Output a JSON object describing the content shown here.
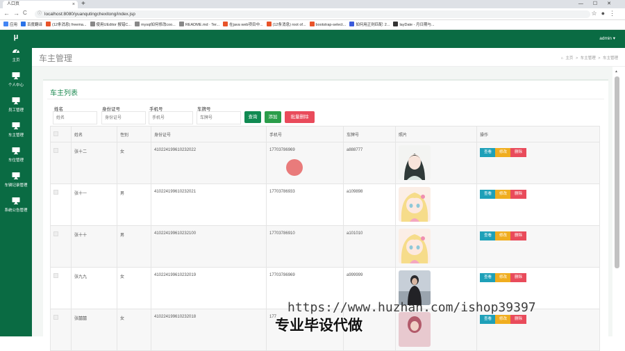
{
  "browser": {
    "tab_title": "人口页",
    "tab_close": "×",
    "new_tab": "+",
    "window_controls": "—☐✕",
    "back": "←",
    "forward": "→",
    "reload": "C",
    "url": "localhost:8080/yuanqutingchexitong/index.jsp",
    "star": "☆"
  },
  "bookmarks": [
    {
      "label": "应用",
      "color": "#4285f4"
    },
    {
      "label": "百度翻译",
      "color": "#2a73e8"
    },
    {
      "label": "(12条消息) freema...",
      "color": "#e8542a"
    },
    {
      "label": "使用UEditor 报错C...",
      "color": "#888888"
    },
    {
      "label": "mysql如何修改coo...",
      "color": "#888888"
    },
    {
      "label": "README.md · Ter...",
      "color": "#888888"
    },
    {
      "label": "在java web项目中...",
      "color": "#e8542a"
    },
    {
      "label": "(12条消息) root of...",
      "color": "#e8542a"
    },
    {
      "label": "bootstrap-select...",
      "color": "#e8542a"
    },
    {
      "label": "如何用正则匹配: 2...",
      "color": "#3b5bdb"
    },
    {
      "label": "layDate - 月日期与...",
      "color": "#333333"
    }
  ],
  "sidebar": {
    "logo": "μ",
    "items": [
      {
        "label": "主页",
        "icon": "dashboard-icon"
      },
      {
        "label": "个人中心",
        "icon": "monitor-icon"
      },
      {
        "label": "员工管理",
        "icon": "monitor-icon"
      },
      {
        "label": "车主管理",
        "icon": "monitor-icon"
      },
      {
        "label": "车位管理",
        "icon": "monitor-icon"
      },
      {
        "label": "车辆记录管理",
        "icon": "monitor-icon"
      },
      {
        "label": "系统公告管理",
        "icon": "monitor-icon"
      }
    ]
  },
  "topbar": {
    "user": "admin ▾"
  },
  "page": {
    "title": "车主管理",
    "crumbs": [
      "主页",
      "车主管理",
      "车主管理"
    ]
  },
  "card": {
    "title": "车主列表"
  },
  "filters": [
    {
      "label": "姓名",
      "placeholder": "姓名"
    },
    {
      "label": "身份证号",
      "placeholder": "身份证号"
    },
    {
      "label": "手机号",
      "placeholder": "手机号"
    },
    {
      "label": "车牌号",
      "placeholder": "车牌号"
    }
  ],
  "buttons": {
    "search": "查询",
    "add": "添加",
    "batch_delete": "批量删除"
  },
  "table": {
    "headers": [
      "姓名",
      "性别",
      "身份证号",
      "手机号",
      "车牌号",
      "照片",
      "操作"
    ],
    "actions": [
      "查看",
      "修改",
      "删除"
    ],
    "rows": [
      {
        "name": "张十二",
        "gender": "女",
        "id": "410224199610232022",
        "phone": "17703786969",
        "plate": "a888777",
        "photo": "girl-illustration"
      },
      {
        "name": "张十一",
        "gender": "男",
        "id": "410224199610232021",
        "phone": "17703786933",
        "plate": "a109898",
        "photo": "anime-girl"
      },
      {
        "name": "张十十",
        "gender": "男",
        "id": "410224199610232100",
        "phone": "17703786910",
        "plate": "a101010",
        "photo": "anime-girl"
      },
      {
        "name": "张九九",
        "gender": "女",
        "id": "410224199610232019",
        "phone": "17703786969",
        "plate": "a999999",
        "photo": "person-photo"
      },
      {
        "name": "张囍囍",
        "gender": "女",
        "id": "410224199610232018",
        "phone": "177",
        "plate": "",
        "photo": "person-photo-2"
      }
    ]
  },
  "colors": {
    "green": "#0a6b43",
    "view": "#1ea0b8",
    "edit": "#f0ad1f",
    "del": "#e94b5b",
    "search_btn": "#108a52",
    "add_btn": "#2a9d4a",
    "batch_btn": "#e94b5b"
  },
  "watermark": {
    "url": "https://www.huzhan.com/ishop39397",
    "text": "专业毕设代做"
  }
}
